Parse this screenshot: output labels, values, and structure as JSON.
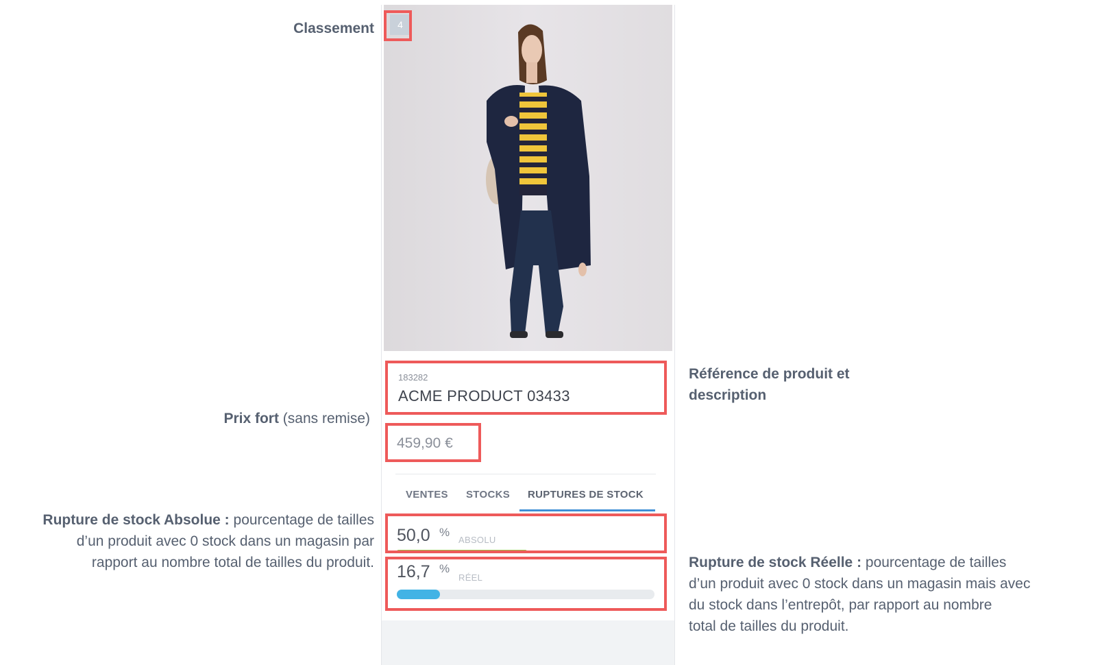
{
  "annotations": {
    "classement": "Classement",
    "prix_bold": "Prix fort",
    "prix_rest": " (sans remise)",
    "reference_line1": "Référence de produit et",
    "reference_line2": "description",
    "absolue_bold": "Rupture de stock Absolue :",
    "absolue_line1_rest": " pourcentage de tailles",
    "absolue_line2": "d’un produit avec 0 stock dans un magasin par",
    "absolue_line3": "rapport au nombre total de tailles du produit.",
    "reelle_bold": "Rupture de stock Réelle :",
    "reelle_line1_rest": " pourcentage de tailles",
    "reelle_line2": "d’un produit avec 0 stock dans un magasin mais avec",
    "reelle_line3": "du stock dans l’entrepôt, par rapport au nombre",
    "reelle_line4": "total de tailles du produit."
  },
  "product": {
    "rank": "4",
    "reference": "183282",
    "name": "ACME PRODUCT 03433",
    "price": "459,90 €"
  },
  "tabs": [
    {
      "label": "VENTES",
      "active": false
    },
    {
      "label": "STOCKS",
      "active": false
    },
    {
      "label": "RUPTURES DE STOCK",
      "active": true
    }
  ],
  "stockout": {
    "absolute": {
      "value": "50,0",
      "unit": "%",
      "caption": "ABSOLU",
      "fraction": 0.5
    },
    "real": {
      "value": "16,7",
      "unit": "%",
      "caption": "RÉEL",
      "fraction": 0.167
    }
  },
  "colors": {
    "highlight": "#ee5a5a",
    "active_tab": "#3f8fd6",
    "absolute_bar": "#9bc04a",
    "real_bar": "#42b3e5"
  }
}
